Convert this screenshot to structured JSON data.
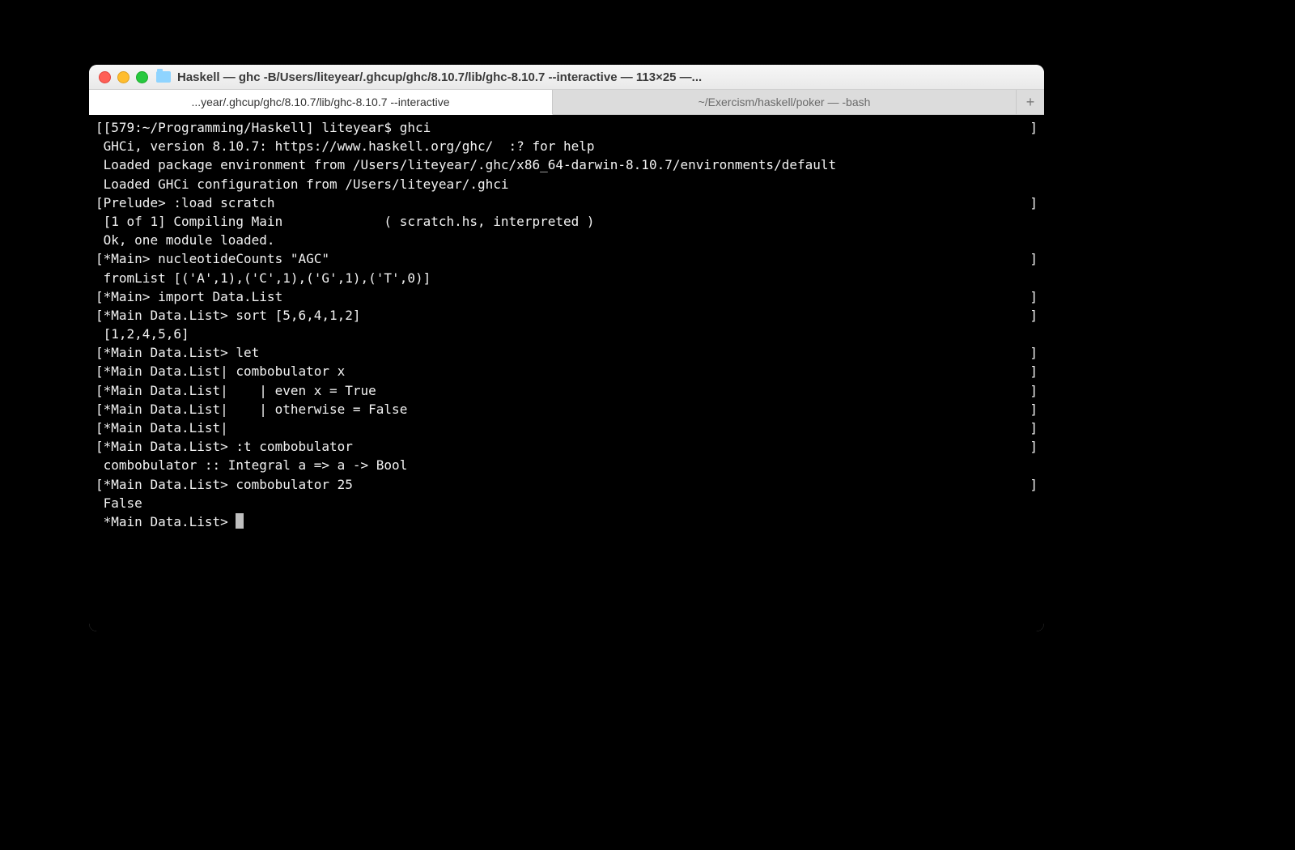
{
  "window": {
    "title": "Haskell — ghc -B/Users/liteyear/.ghcup/ghc/8.10.7/lib/ghc-8.10.7 --interactive — 113×25 —..."
  },
  "tabs": {
    "active": "...year/.ghcup/ghc/8.10.7/lib/ghc-8.10.7 --interactive",
    "inactive": "~/Exercism/haskell/poker — -bash",
    "add": "+"
  },
  "terminal": {
    "lines": [
      {
        "l": "[",
        "t": "[579:~/Programming/Haskell] liteyear$ ghci",
        "r": "]"
      },
      {
        "l": " ",
        "t": "GHCi, version 8.10.7: https://www.haskell.org/ghc/  :? for help",
        "r": " "
      },
      {
        "l": " ",
        "t": "Loaded package environment from /Users/liteyear/.ghc/x86_64-darwin-8.10.7/environments/default",
        "r": " "
      },
      {
        "l": " ",
        "t": "Loaded GHCi configuration from /Users/liteyear/.ghci",
        "r": " "
      },
      {
        "l": "[",
        "t": "Prelude> :load scratch",
        "r": "]"
      },
      {
        "l": " ",
        "t": "[1 of 1] Compiling Main             ( scratch.hs, interpreted )",
        "r": " "
      },
      {
        "l": " ",
        "t": "Ok, one module loaded.",
        "r": " "
      },
      {
        "l": "[",
        "t": "*Main> nucleotideCounts \"AGC\"",
        "r": "]"
      },
      {
        "l": " ",
        "t": "fromList [('A',1),('C',1),('G',1),('T',0)]",
        "r": " "
      },
      {
        "l": "[",
        "t": "*Main> import Data.List",
        "r": "]"
      },
      {
        "l": "[",
        "t": "*Main Data.List> sort [5,6,4,1,2]",
        "r": "]"
      },
      {
        "l": " ",
        "t": "[1,2,4,5,6]",
        "r": " "
      },
      {
        "l": "[",
        "t": "*Main Data.List> let",
        "r": "]"
      },
      {
        "l": "[",
        "t": "*Main Data.List| combobulator x",
        "r": "]"
      },
      {
        "l": "[",
        "t": "*Main Data.List|    | even x = True",
        "r": "]"
      },
      {
        "l": "[",
        "t": "*Main Data.List|    | otherwise = False",
        "r": "]"
      },
      {
        "l": "[",
        "t": "*Main Data.List|",
        "r": "]"
      },
      {
        "l": "[",
        "t": "*Main Data.List> :t combobulator",
        "r": "]"
      },
      {
        "l": " ",
        "t": "combobulator :: Integral a => a -> Bool",
        "r": " "
      },
      {
        "l": "[",
        "t": "*Main Data.List> combobulator 25",
        "r": "]"
      },
      {
        "l": " ",
        "t": "False",
        "r": " "
      }
    ],
    "prompt": "*Main Data.List> "
  }
}
